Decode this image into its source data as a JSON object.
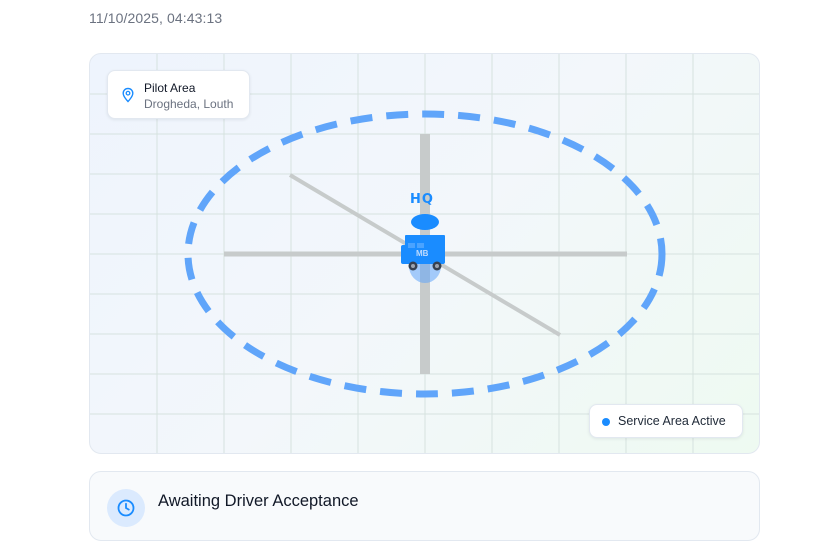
{
  "header": {
    "timestamp": "11/10/2025, 04:43:13"
  },
  "map": {
    "location": {
      "title": "Pilot Area",
      "subtitle": "Drogheda, Louth",
      "icon": "map-pin-icon"
    },
    "hq_label": "HQ",
    "vehicle_label": "MB",
    "vehicle_icon": "bus-icon",
    "service_status": {
      "label": "Service Area Active",
      "color": "#1a8cff"
    },
    "colors": {
      "accent": "#1a8cff",
      "service_ring": "#60a5fa",
      "road": "#c7cbcb"
    }
  },
  "request_card": {
    "title": "Awaiting Driver Acceptance",
    "icon": "clock-icon"
  }
}
